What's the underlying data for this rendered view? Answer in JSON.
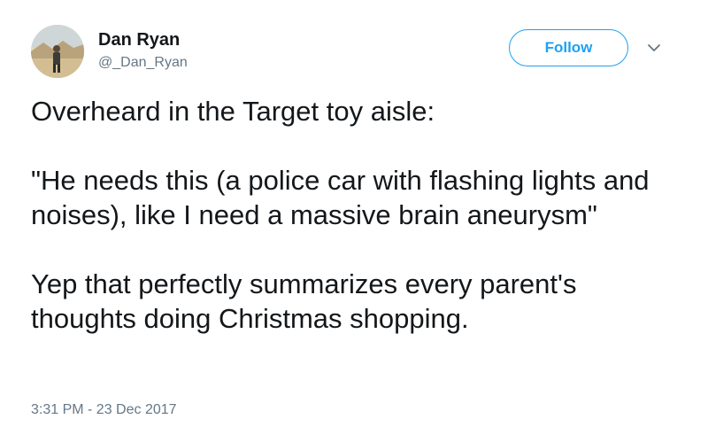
{
  "author": {
    "name": "Dan Ryan",
    "handle": "@_Dan_Ryan",
    "avatar_icon": "user-avatar-photo"
  },
  "actions": {
    "follow_label": "Follow",
    "menu_icon": "chevron-down-icon",
    "accent_color": "#1da1f2"
  },
  "tweet": {
    "paragraphs": [
      "Overheard in the Target toy aisle:",
      "\"He needs this (a police car with flashing lights and noises), like I need a massive brain aneurysm\"",
      "Yep that perfectly summarizes every parent's thoughts doing Christmas shopping."
    ],
    "timestamp": "3:31 PM - 23 Dec 2017"
  }
}
